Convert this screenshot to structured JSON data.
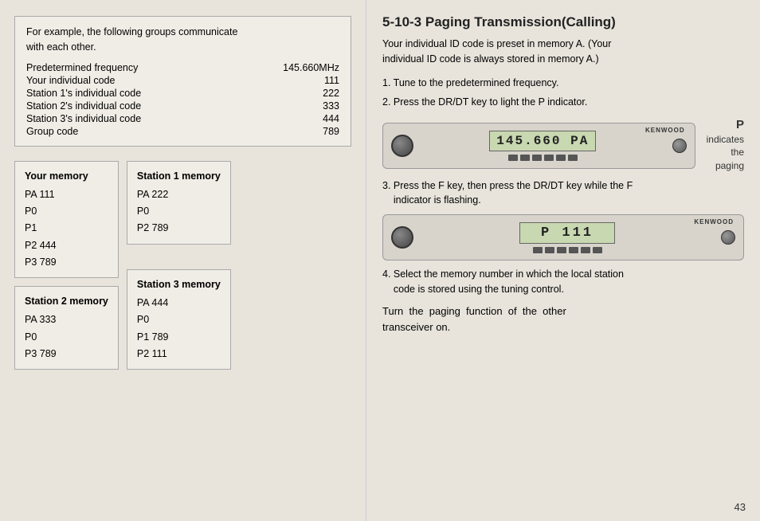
{
  "left": {
    "intro": {
      "line1": "For example, the following groups communicate",
      "line2": "with each other."
    },
    "freq_label": "Predetermined frequency",
    "freq_value": "145.660MHz",
    "rows": [
      {
        "label": "Your individual code",
        "value": "111"
      },
      {
        "label": "Station 1's individual code",
        "value": "222"
      },
      {
        "label": "Station 2's individual code",
        "value": "333"
      },
      {
        "label": "Station 3's individual code",
        "value": "444"
      },
      {
        "label": "Group code",
        "value": "789"
      }
    ],
    "your_memory": {
      "title": "Your memory",
      "entries": [
        "PA  111",
        "P0",
        "P1",
        "P2  444",
        "P3  789"
      ]
    },
    "station1_memory": {
      "title": "Station 1 memory",
      "entries": [
        "PA  222",
        "P0",
        "P2  789"
      ]
    },
    "station2_memory": {
      "title": "Station 2 memory",
      "entries": [
        "PA  333",
        "P0",
        "P3  789"
      ]
    },
    "station3_memory": {
      "title": "Station 3 memory",
      "entries": [
        "PA  444",
        "P0",
        "P1  789",
        "P2  111"
      ]
    }
  },
  "right": {
    "section_title": "5-10-3  Paging Transmission(Calling)",
    "intro_line1": "Your individual ID code is preset in memory A. (Your",
    "intro_line2": "individual ID code is always stored in memory A.)",
    "steps": [
      "1. Tune to the predetermined frequency.",
      "2. Press the DR/DT key to light the P indicator."
    ],
    "radio1_display": "145.660  PA",
    "p_indicator": "P",
    "p_labels": [
      "indicates",
      "the",
      "paging"
    ],
    "step3": "3. Press the F key, then press the DR/DT key while the F\n    indicator is flashing.",
    "radio2_display": "P 111",
    "step4": "4. Select the memory number in which the local station\n    code is stored using the tuning control.",
    "turn_line": "Turn  the  paging  function  of  the  other\ntransceiver on.",
    "page_num": "43"
  }
}
